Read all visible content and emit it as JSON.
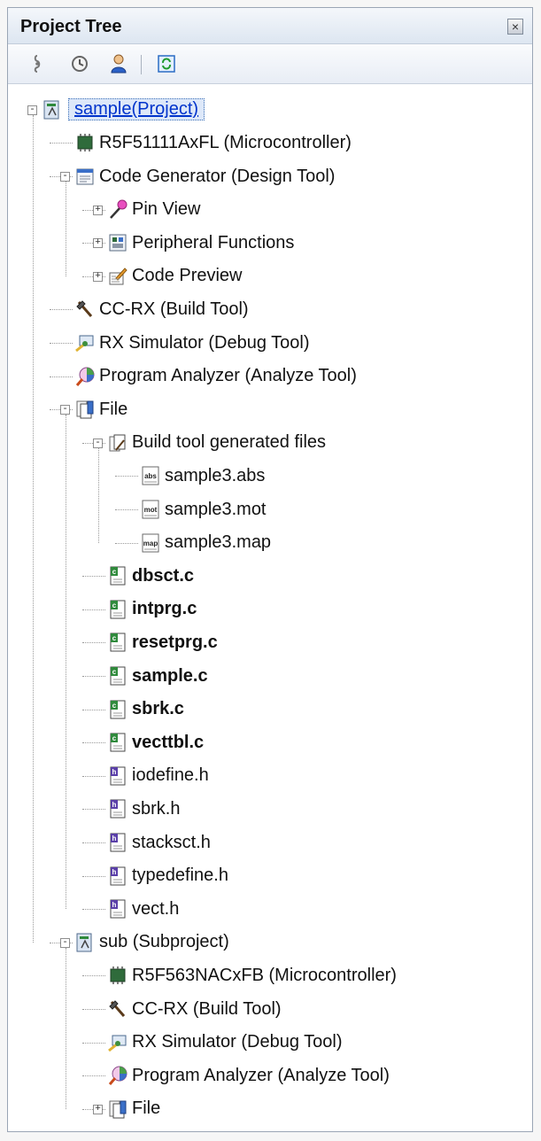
{
  "panel": {
    "title": "Project Tree",
    "close_symbol": "×",
    "toolbar": [
      {
        "name": "property-icon"
      },
      {
        "name": "history-icon"
      },
      {
        "name": "user-icon"
      },
      {
        "name": "refresh-icon"
      }
    ]
  },
  "tree": {
    "nodes": [
      {
        "label": "sample(Project)",
        "icon": "project-icon",
        "expander": "-",
        "bold": false,
        "selected": true
      },
      {
        "label": "R5F51111AxFL (Microcontroller)",
        "icon": "microcontroller-icon",
        "bold": false
      },
      {
        "label": "Code Generator (Design Tool)",
        "icon": "code-generator-icon",
        "expander": "-",
        "bold": false
      },
      {
        "label": "Pin View",
        "icon": "pin-view-icon",
        "expander": "+",
        "bold": false
      },
      {
        "label": "Peripheral Functions",
        "icon": "peripheral-icon",
        "expander": "+",
        "bold": false
      },
      {
        "label": "Code Preview",
        "icon": "code-preview-icon",
        "expander": "+",
        "bold": false
      },
      {
        "label": "CC-RX (Build Tool)",
        "icon": "build-tool-icon",
        "bold": false
      },
      {
        "label": "RX Simulator (Debug Tool)",
        "icon": "debug-tool-icon",
        "bold": false
      },
      {
        "label": "Program Analyzer (Analyze Tool)",
        "icon": "analyzer-icon",
        "bold": false
      },
      {
        "label": "File",
        "icon": "file-folder-icon",
        "expander": "-",
        "bold": false
      },
      {
        "label": "Build tool generated files",
        "icon": "generated-files-icon",
        "expander": "-",
        "bold": false
      },
      {
        "label": "sample3.abs",
        "icon": "abs-file-icon",
        "badge": "abs",
        "bold": false
      },
      {
        "label": "sample3.mot",
        "icon": "mot-file-icon",
        "badge": "mot",
        "bold": false
      },
      {
        "label": "sample3.map",
        "icon": "map-file-icon",
        "badge": "map",
        "bold": false
      },
      {
        "label": "dbsct.c",
        "icon": "c-file-icon",
        "bold": true
      },
      {
        "label": "intprg.c",
        "icon": "c-file-icon",
        "bold": true
      },
      {
        "label": "resetprg.c",
        "icon": "c-file-icon",
        "bold": true
      },
      {
        "label": "sample.c",
        "icon": "c-file-icon",
        "bold": true
      },
      {
        "label": "sbrk.c",
        "icon": "c-file-icon",
        "bold": true
      },
      {
        "label": "vecttbl.c",
        "icon": "c-file-icon",
        "bold": true
      },
      {
        "label": "iodefine.h",
        "icon": "h-file-icon",
        "bold": false
      },
      {
        "label": "sbrk.h",
        "icon": "h-file-icon",
        "bold": false
      },
      {
        "label": "stacksct.h",
        "icon": "h-file-icon",
        "bold": false
      },
      {
        "label": "typedefine.h",
        "icon": "h-file-icon",
        "bold": false
      },
      {
        "label": "vect.h",
        "icon": "h-file-icon",
        "bold": false
      },
      {
        "label": "sub (Subproject)",
        "icon": "subproject-icon",
        "expander": "-",
        "bold": false
      },
      {
        "label": "R5F563NACxFB (Microcontroller)",
        "icon": "microcontroller-icon",
        "bold": false
      },
      {
        "label": "CC-RX (Build Tool)",
        "icon": "build-tool-icon",
        "bold": false
      },
      {
        "label": "RX Simulator (Debug Tool)",
        "icon": "debug-tool-icon",
        "bold": false
      },
      {
        "label": "Program Analyzer (Analyze Tool)",
        "icon": "analyzer-icon",
        "bold": false
      },
      {
        "label": "File",
        "icon": "file-folder-icon",
        "expander": "+",
        "bold": false
      }
    ]
  }
}
